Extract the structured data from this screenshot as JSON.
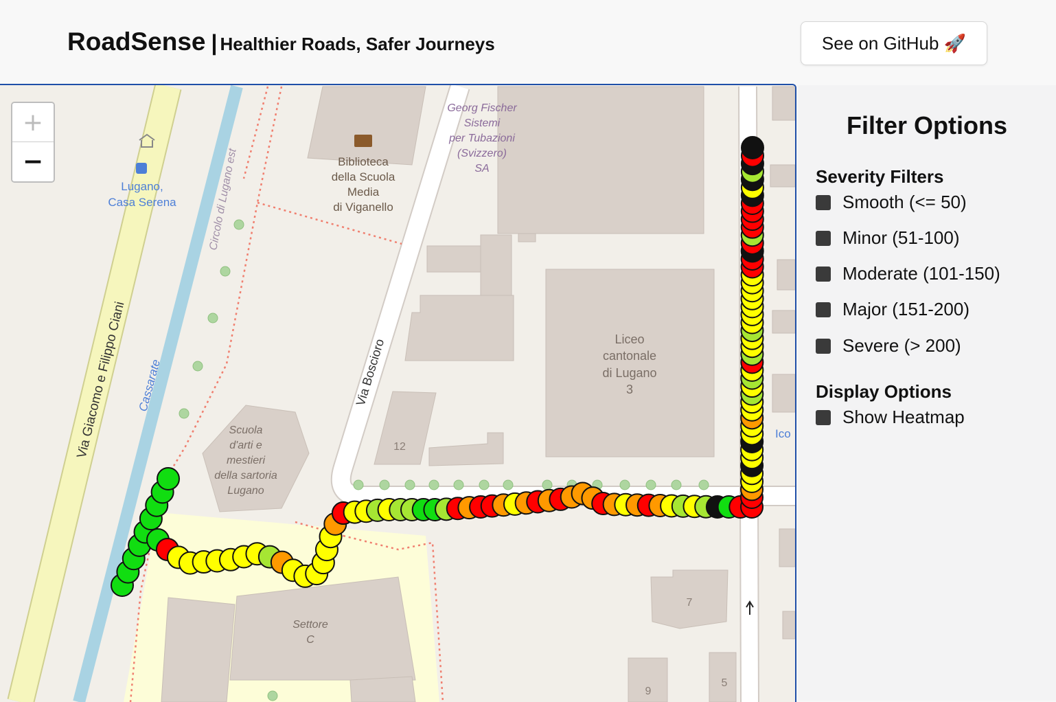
{
  "header": {
    "brand": "RoadSense",
    "separator": "|",
    "tagline": "Healthier Roads, Safer Journeys",
    "github_label": "See on GitHub 🚀"
  },
  "map": {
    "zoom_in": "+",
    "zoom_out": "−",
    "labels": {
      "bus_stop": [
        "Lugano,",
        "Casa Serena"
      ],
      "library": [
        "Biblioteca",
        "della Scuola",
        "Media",
        "di Viganello"
      ],
      "georg": [
        "Georg Fischer",
        "Sistemi",
        "per Tubazioni",
        "(Svizzero)",
        "SA"
      ],
      "liceo": [
        "Liceo",
        "cantonale",
        "di Lugano",
        "3"
      ],
      "scuola": [
        "Scuola",
        "d'arti e",
        "mestieri",
        "della sartoria",
        "Lugano"
      ],
      "settore": [
        "Settore",
        "C"
      ],
      "street_ciani": "Via Giacomo e Filippo Ciani",
      "street_boscioro": "Via Boscioro",
      "river": "Cassarate",
      "circolo": "Circolo di Lugano est",
      "num_12": "12",
      "num_7": "7",
      "num_9": "9",
      "num_5": "5",
      "ico": "Ico"
    },
    "severity_colors": {
      "smooth": "#11dd11",
      "minor": "#a6e633",
      "moderate": "#ffff00",
      "major": "#ff9900",
      "severe": "#ff0000",
      "black": "#111111"
    },
    "points": [
      [
        "smooth",
        "smooth",
        "smooth",
        "smooth",
        "smooth",
        "smooth",
        "smooth",
        "smooth",
        "smooth"
      ],
      [
        "smooth",
        "severe",
        "moderate",
        "moderate",
        "moderate",
        "moderate",
        "moderate",
        "moderate",
        "moderate",
        "minor",
        "major",
        "moderate",
        "moderate",
        "moderate",
        "moderate",
        "moderate",
        "moderate",
        "major",
        "severe"
      ],
      [
        "severe",
        "moderate",
        "moderate",
        "minor",
        "moderate",
        "minor",
        "minor",
        "smooth",
        "smooth",
        "minor",
        "severe",
        "major",
        "severe",
        "severe",
        "major",
        "moderate",
        "major",
        "severe",
        "major",
        "severe",
        "major",
        "major",
        "major",
        "severe",
        "major",
        "moderate",
        "major",
        "severe",
        "major",
        "moderate",
        "minor",
        "moderate",
        "minor",
        "black",
        "smooth",
        "severe",
        "severe"
      ],
      [
        "severe",
        "major",
        "moderate",
        "moderate",
        "black",
        "moderate",
        "moderate",
        "black",
        "moderate",
        "moderate",
        "major",
        "moderate",
        "moderate",
        "minor",
        "moderate",
        "minor",
        "moderate",
        "severe",
        "minor",
        "moderate",
        "moderate",
        "minor",
        "moderate",
        "moderate",
        "moderate",
        "moderate",
        "moderate",
        "moderate",
        "moderate",
        "severe",
        "severe",
        "black",
        "severe",
        "minor",
        "severe",
        "severe",
        "severe",
        "severe",
        "black",
        "moderate",
        "black",
        "minor",
        "black",
        "severe",
        "black"
      ]
    ]
  },
  "sidebar": {
    "title": "Filter Options",
    "severity_heading": "Severity Filters",
    "filters": [
      {
        "label": "Smooth (<= 50)"
      },
      {
        "label": "Minor (51-100)"
      },
      {
        "label": "Moderate (101-150)"
      },
      {
        "label": "Major (151-200)"
      },
      {
        "label": "Severe (> 200)"
      }
    ],
    "display_heading": "Display Options",
    "heatmap_label": "Show Heatmap"
  }
}
